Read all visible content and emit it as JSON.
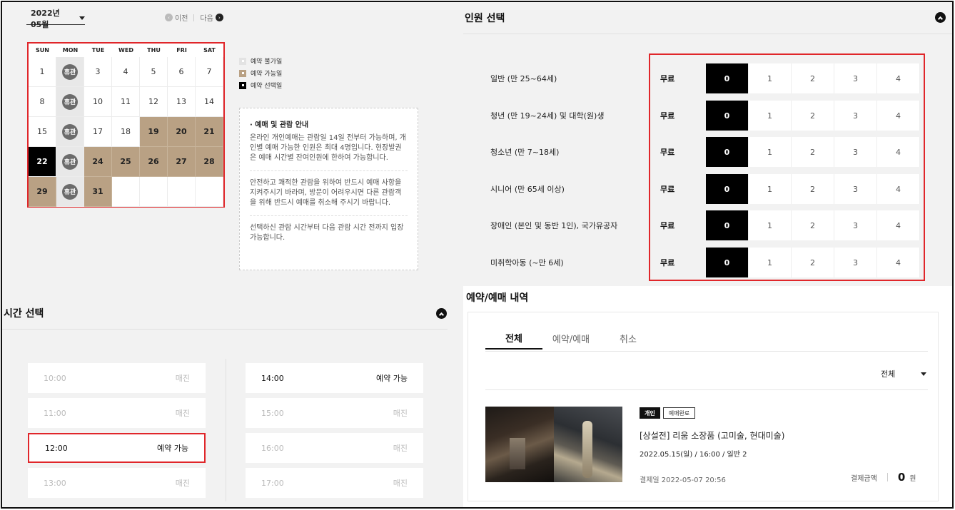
{
  "calendar": {
    "month_label": "2022년 05월",
    "prev_label": "이전",
    "next_label": "다음",
    "weekdays": [
      "SUN",
      "MON",
      "TUE",
      "WED",
      "THU",
      "FRI",
      "SAT"
    ],
    "closed_label": "휴관",
    "weeks": [
      [
        "1",
        "휴관",
        "3",
        "4",
        "5",
        "6",
        "7"
      ],
      [
        "8",
        "휴관",
        "10",
        "11",
        "12",
        "13",
        "14"
      ],
      [
        "15",
        "휴관",
        "17",
        "18",
        "19",
        "20",
        "21"
      ],
      [
        "22",
        "휴관",
        "24",
        "25",
        "26",
        "27",
        "28"
      ],
      [
        "29",
        "휴관",
        "31",
        "",
        "",
        "",
        ""
      ]
    ]
  },
  "legend": {
    "unavailable": "예약 불가일",
    "available": "예약 가능일",
    "selected": "예약 선택일"
  },
  "notice": {
    "title": "· 예매 및 관람 안내",
    "p1": "온라인 개인예매는 관람일 14일 전부터 가능하며, 개인별 예매 가능한 인원은 최대 4명입니다. 현장발권은 예매 시간별 잔여인원에 한하여 가능합니다.",
    "p2": "안전하고 쾌적한 관람을 위하여 반드시 예매 사항을 지켜주시기 바라며, 방문이 어려우시면 다른 관람객을 위해 반드시 예매를 취소해 주시기 바랍니다.",
    "p3": "선택하신 관람 시간부터 다음 관람 시간 전까지 입장 가능합니다."
  },
  "time": {
    "title": "시간 선택",
    "slots_left": [
      {
        "time": "10:00",
        "status": "매진"
      },
      {
        "time": "11:00",
        "status": "매진"
      },
      {
        "time": "12:00",
        "status": "예약 가능"
      },
      {
        "time": "13:00",
        "status": "매진"
      }
    ],
    "slots_right": [
      {
        "time": "14:00",
        "status": "예약 가능"
      },
      {
        "time": "15:00",
        "status": "매진"
      },
      {
        "time": "16:00",
        "status": "매진"
      },
      {
        "time": "17:00",
        "status": "매진"
      }
    ]
  },
  "people": {
    "title": "인원 선택",
    "price_label": "무료",
    "counts": [
      "0",
      "1",
      "2",
      "3",
      "4"
    ],
    "rows": [
      {
        "label": "일반 (만 25~64세)"
      },
      {
        "label": "청년 (만 19~24세) 및 대학(원)생"
      },
      {
        "label": "청소년 (만 7~18세)"
      },
      {
        "label": "시니어 (만 65세 이상)"
      },
      {
        "label": "장애인 (본인 및 동반 1인), 국가유공자"
      },
      {
        "label": "미취학아동 (~만 6세)"
      }
    ]
  },
  "history": {
    "title": "예약/예매 내역",
    "tabs": [
      "전체",
      "예약/예매",
      "취소"
    ],
    "filter": "전체",
    "item": {
      "badge1": "개인",
      "badge2": "예매완료",
      "title": "[상설전] 리움 소장품 (고미술, 현대미술)",
      "info": "2022.05.15(일) / 16:00 / 일반 2",
      "paid_date": "결제일 2022-05-07 20:56",
      "amount_label": "결제금액",
      "amount": "0",
      "currency": "원"
    }
  }
}
